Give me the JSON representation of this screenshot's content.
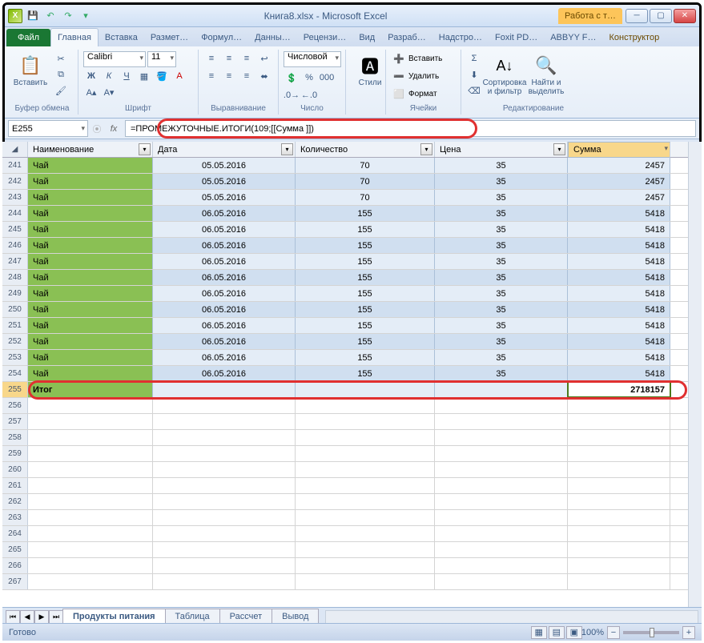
{
  "window": {
    "title": "Книга8.xlsx - Microsoft Excel",
    "tabletools": "Работа с т…"
  },
  "ribbon_tabs": {
    "file": "Файл",
    "home": "Главная",
    "insert": "Вставка",
    "layout": "Размет…",
    "formulas": "Формул…",
    "data": "Данны…",
    "review": "Рецензи…",
    "view": "Вид",
    "developer": "Разраб…",
    "addins": "Надстро…",
    "foxit": "Foxit PD…",
    "abbyy": "ABBYY F…",
    "construct": "Конструктор"
  },
  "ribbon": {
    "clipboard": {
      "paste": "Вставить",
      "label": "Буфер обмена"
    },
    "font": {
      "name": "Calibri",
      "size": "11",
      "label": "Шрифт"
    },
    "align": {
      "label": "Выравнивание"
    },
    "number": {
      "format": "Числовой",
      "label": "Число"
    },
    "styles": {
      "btn": "Стили"
    },
    "cells": {
      "insert": "Вставить",
      "delete": "Удалить",
      "format": "Формат",
      "label": "Ячейки"
    },
    "editing": {
      "sort": "Сортировка и фильтр",
      "find": "Найти и выделить",
      "label": "Редактирование"
    }
  },
  "formula_bar": {
    "cell_ref": "E255",
    "formula": "=ПРОМЕЖУТОЧНЫЕ.ИТОГИ(109;[[Сумма ]])"
  },
  "headers": {
    "name": "Наименование",
    "date": "Дата",
    "qty": "Количество",
    "price": "Цена",
    "sum": "Сумма"
  },
  "rows": [
    {
      "n": 241,
      "name": "Чай",
      "date": "05.05.2016",
      "qty": "70",
      "price": "35",
      "sum": "2457"
    },
    {
      "n": 242,
      "name": "Чай",
      "date": "05.05.2016",
      "qty": "70",
      "price": "35",
      "sum": "2457"
    },
    {
      "n": 243,
      "name": "Чай",
      "date": "05.05.2016",
      "qty": "70",
      "price": "35",
      "sum": "2457"
    },
    {
      "n": 244,
      "name": "Чай",
      "date": "06.05.2016",
      "qty": "155",
      "price": "35",
      "sum": "5418"
    },
    {
      "n": 245,
      "name": "Чай",
      "date": "06.05.2016",
      "qty": "155",
      "price": "35",
      "sum": "5418"
    },
    {
      "n": 246,
      "name": "Чай",
      "date": "06.05.2016",
      "qty": "155",
      "price": "35",
      "sum": "5418"
    },
    {
      "n": 247,
      "name": "Чай",
      "date": "06.05.2016",
      "qty": "155",
      "price": "35",
      "sum": "5418"
    },
    {
      "n": 248,
      "name": "Чай",
      "date": "06.05.2016",
      "qty": "155",
      "price": "35",
      "sum": "5418"
    },
    {
      "n": 249,
      "name": "Чай",
      "date": "06.05.2016",
      "qty": "155",
      "price": "35",
      "sum": "5418"
    },
    {
      "n": 250,
      "name": "Чай",
      "date": "06.05.2016",
      "qty": "155",
      "price": "35",
      "sum": "5418"
    },
    {
      "n": 251,
      "name": "Чай",
      "date": "06.05.2016",
      "qty": "155",
      "price": "35",
      "sum": "5418"
    },
    {
      "n": 252,
      "name": "Чай",
      "date": "06.05.2016",
      "qty": "155",
      "price": "35",
      "sum": "5418"
    },
    {
      "n": 253,
      "name": "Чай",
      "date": "06.05.2016",
      "qty": "155",
      "price": "35",
      "sum": "5418"
    },
    {
      "n": 254,
      "name": "Чай",
      "date": "06.05.2016",
      "qty": "155",
      "price": "35",
      "sum": "5418"
    }
  ],
  "total_row": {
    "n": 255,
    "name": "Итог",
    "sum": "2718157"
  },
  "empty_rows": [
    256,
    257,
    258,
    259,
    260,
    261,
    262,
    263,
    264,
    265,
    266,
    267
  ],
  "sheets": {
    "active": "Продукты питания",
    "others": [
      "Таблица",
      "Рассчет",
      "Вывод"
    ]
  },
  "status": {
    "ready": "Готово",
    "zoom": "100%"
  }
}
